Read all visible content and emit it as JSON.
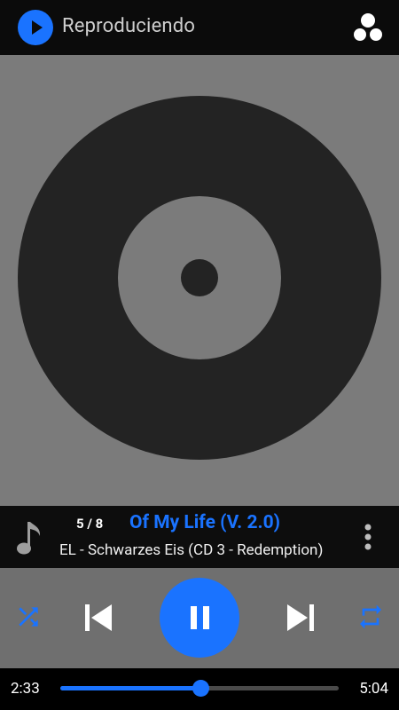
{
  "header": {
    "title": "Reproduciendo",
    "app_icon": "play-circle-icon",
    "action_icon": "cast-icon"
  },
  "album_art": {
    "placeholder_icon": "vinyl-disc-icon"
  },
  "track": {
    "position": "5 / 8",
    "title": "Of My Life (V. 2.0)",
    "subtitle": "EL - Schwarzes Eis (CD 3 - Redemption)",
    "note_icon": "music-note-icon",
    "menu_icon": "more-vertical-icon"
  },
  "controls": {
    "shuffle_icon": "shuffle-icon",
    "previous_icon": "skip-previous-icon",
    "play_pause_icon": "pause-icon",
    "next_icon": "skip-next-icon",
    "repeat_icon": "repeat-icon"
  },
  "playback": {
    "current_time": "2:33",
    "total_time": "5:04",
    "progress": 0.503
  },
  "colors": {
    "accent": "#1a73ff",
    "appbar_bg": "#0b0b0b",
    "art_bg": "#7b7b7b",
    "disc": "#232323",
    "controls_bg": "#6f6f6f"
  }
}
